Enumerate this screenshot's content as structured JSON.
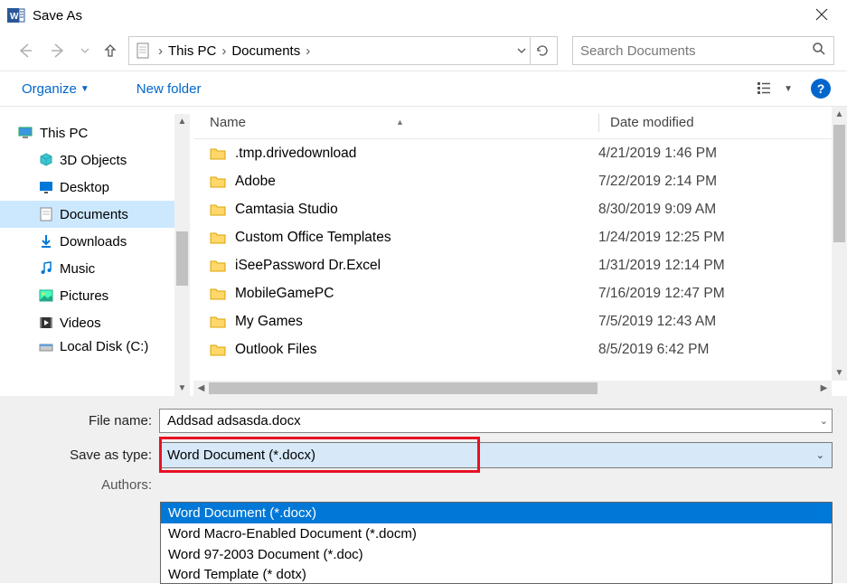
{
  "title": "Save As",
  "breadcrumbs": [
    "This PC",
    "Documents"
  ],
  "search_placeholder": "Search Documents",
  "toolbar": {
    "organize": "Organize",
    "new_folder": "New folder"
  },
  "tree": {
    "root": "This PC",
    "items": [
      {
        "label": "3D Objects",
        "icon": "cube"
      },
      {
        "label": "Desktop",
        "icon": "desktop"
      },
      {
        "label": "Documents",
        "icon": "document",
        "selected": true
      },
      {
        "label": "Downloads",
        "icon": "download"
      },
      {
        "label": "Music",
        "icon": "music"
      },
      {
        "label": "Pictures",
        "icon": "pictures"
      },
      {
        "label": "Videos",
        "icon": "videos"
      },
      {
        "label": "Local Disk (C:)",
        "icon": "disk",
        "cutoff": true
      }
    ]
  },
  "columns": {
    "name": "Name",
    "date": "Date modified"
  },
  "files": [
    {
      "name": ".tmp.drivedownload",
      "date": "4/21/2019 1:46 PM"
    },
    {
      "name": "Adobe",
      "date": "7/22/2019 2:14 PM"
    },
    {
      "name": "Camtasia Studio",
      "date": "8/30/2019 9:09 AM"
    },
    {
      "name": "Custom Office Templates",
      "date": "1/24/2019 12:25 PM"
    },
    {
      "name": "iSeePassword Dr.Excel",
      "date": "1/31/2019 12:14 PM"
    },
    {
      "name": "MobileGamePC",
      "date": "7/16/2019 12:47 PM"
    },
    {
      "name": "My Games",
      "date": "7/5/2019 12:43 AM"
    },
    {
      "name": "Outlook Files",
      "date": "8/5/2019 6:42 PM"
    }
  ],
  "form": {
    "filename_label": "File name:",
    "filename_value": "Addsad adsasda.docx",
    "type_label": "Save as type:",
    "type_value": "Word Document (*.docx)",
    "authors_label": "Authors:"
  },
  "type_options": [
    "Word Document (*.docx)",
    "Word Macro-Enabled Document (*.docm)",
    "Word 97-2003 Document (*.doc)",
    "Word Template (* dotx)"
  ]
}
